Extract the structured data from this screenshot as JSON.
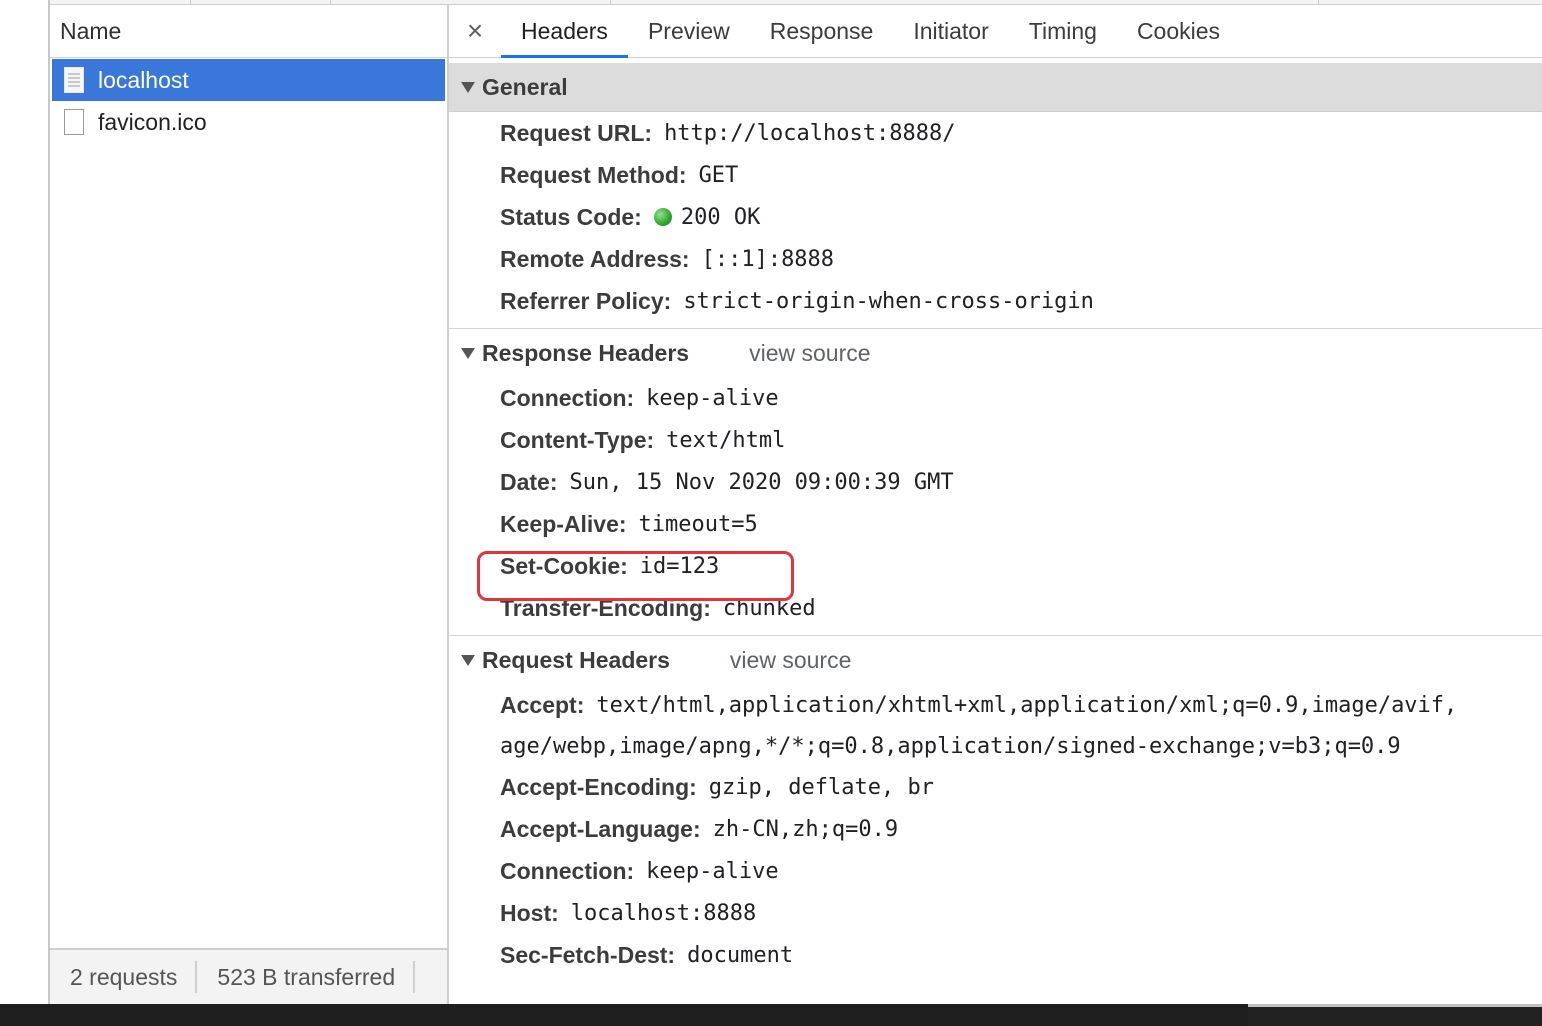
{
  "list": {
    "header": "Name",
    "requests": [
      {
        "name": "localhost",
        "selected": true
      },
      {
        "name": "favicon.ico",
        "selected": false
      }
    ],
    "status": {
      "requests": "2 requests",
      "transferred": "523 B transferred"
    }
  },
  "tabs": {
    "close": "×",
    "items": [
      "Headers",
      "Preview",
      "Response",
      "Initiator",
      "Timing",
      "Cookies"
    ],
    "active": "Headers"
  },
  "general": {
    "title": "General",
    "request_url_key": "Request URL:",
    "request_url": "http://localhost:8888/",
    "method_key": "Request Method:",
    "method": "GET",
    "status_key": "Status Code:",
    "status": "200 OK",
    "status_color": "#2fa52f",
    "remote_key": "Remote Address:",
    "remote": "[::1]:8888",
    "referrer_key": "Referrer Policy:",
    "referrer": "strict-origin-when-cross-origin"
  },
  "response_headers": {
    "title": "Response Headers",
    "view_source": "view source",
    "items": [
      {
        "k": "Connection:",
        "v": "keep-alive"
      },
      {
        "k": "Content-Type:",
        "v": "text/html"
      },
      {
        "k": "Date:",
        "v": "Sun, 15 Nov 2020 09:00:39 GMT"
      },
      {
        "k": "Keep-Alive:",
        "v": "timeout=5"
      },
      {
        "k": "Set-Cookie:",
        "v": "id=123"
      },
      {
        "k": "Transfer-Encoding:",
        "v": "chunked"
      }
    ],
    "highlight_color": "#e0353b"
  },
  "request_headers": {
    "title": "Request Headers",
    "view_source": "view source",
    "accept_key": "Accept:",
    "accept_line1": "text/html,application/xhtml+xml,application/xml;q=0.9,image/avif,",
    "accept_line2": "age/webp,image/apng,*/*;q=0.8,application/signed-exchange;v=b3;q=0.9",
    "items": [
      {
        "k": "Accept-Encoding:",
        "v": "gzip, deflate, br"
      },
      {
        "k": "Accept-Language:",
        "v": "zh-CN,zh;q=0.9"
      },
      {
        "k": "Connection:",
        "v": "keep-alive"
      },
      {
        "k": "Host:",
        "v": "localhost:8888"
      },
      {
        "k": "Sec-Fetch-Dest:",
        "v": "document"
      }
    ]
  },
  "colors": {
    "selected_row": "#3a77db",
    "active_tab_underline": "#1a73e8"
  }
}
